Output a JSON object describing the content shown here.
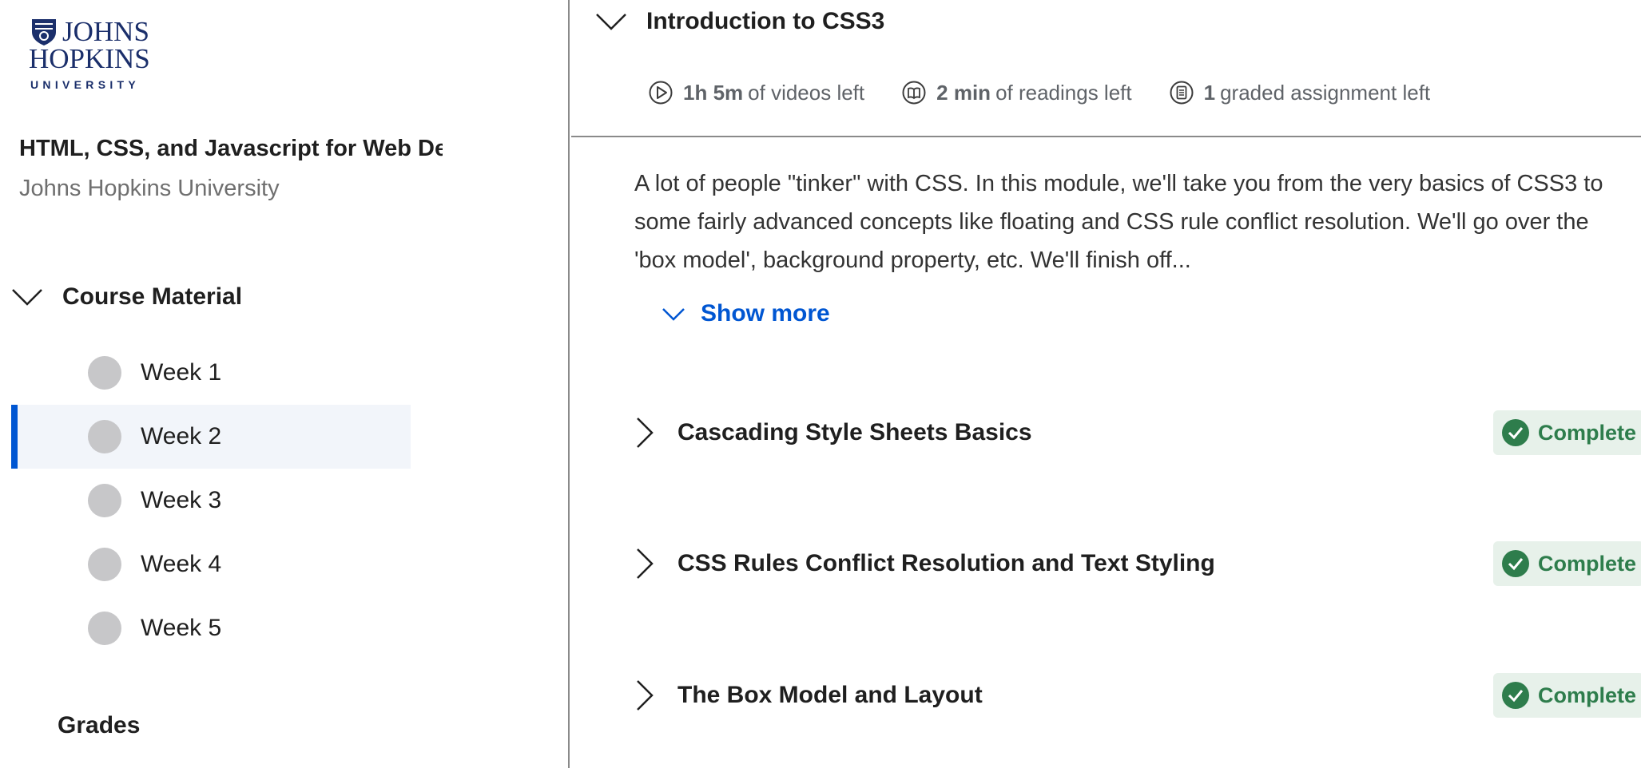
{
  "logo": {
    "line1": "JOHNS",
    "line2": "HOPKINS",
    "line3": "UNIVERSITY"
  },
  "sidebar": {
    "course_title": "HTML, CSS, and Javascript for Web Developers",
    "partner": "Johns Hopkins University",
    "section_label": "Course Material",
    "weeks": [
      {
        "label": "Week 1"
      },
      {
        "label": "Week 2"
      },
      {
        "label": "Week 3"
      },
      {
        "label": "Week 4"
      },
      {
        "label": "Week 5"
      }
    ],
    "active_week": "Week 2",
    "grades_label": "Grades"
  },
  "module": {
    "title": "Introduction to CSS3",
    "stats": {
      "videos_value": "1h 5m",
      "videos_text": "of videos left",
      "readings_value": "2 min",
      "readings_text": "of readings left",
      "assign_value": "1",
      "assign_text": "graded assignment left"
    },
    "description": "A lot of people \"tinker\" with CSS. In this module, we'll take you from the very basics of CSS3 to some fairly advanced concepts like floating and CSS rule conflict resolution. We'll go over the 'box model', background property, etc. We'll finish off...",
    "show_more": "Show more",
    "lessons": [
      {
        "title": "Cascading Style Sheets Basics",
        "status": "Complete"
      },
      {
        "title": "CSS Rules Conflict Resolution and Text Styling",
        "status": "Complete"
      },
      {
        "title": "The Box Model and Layout",
        "status": "Complete"
      }
    ]
  },
  "colors": {
    "accent": "#0056d2",
    "complete_text": "#2e7d4c",
    "complete_bg": "#e7f1ea",
    "logo": "#1b2f6b"
  },
  "icons": {
    "section_toggle": "chevron-down-icon",
    "video": "play-circle-icon",
    "reading": "book-icon",
    "assignment": "assignment-icon",
    "lesson_toggle": "chevron-right-icon",
    "complete": "check-circle-icon"
  }
}
